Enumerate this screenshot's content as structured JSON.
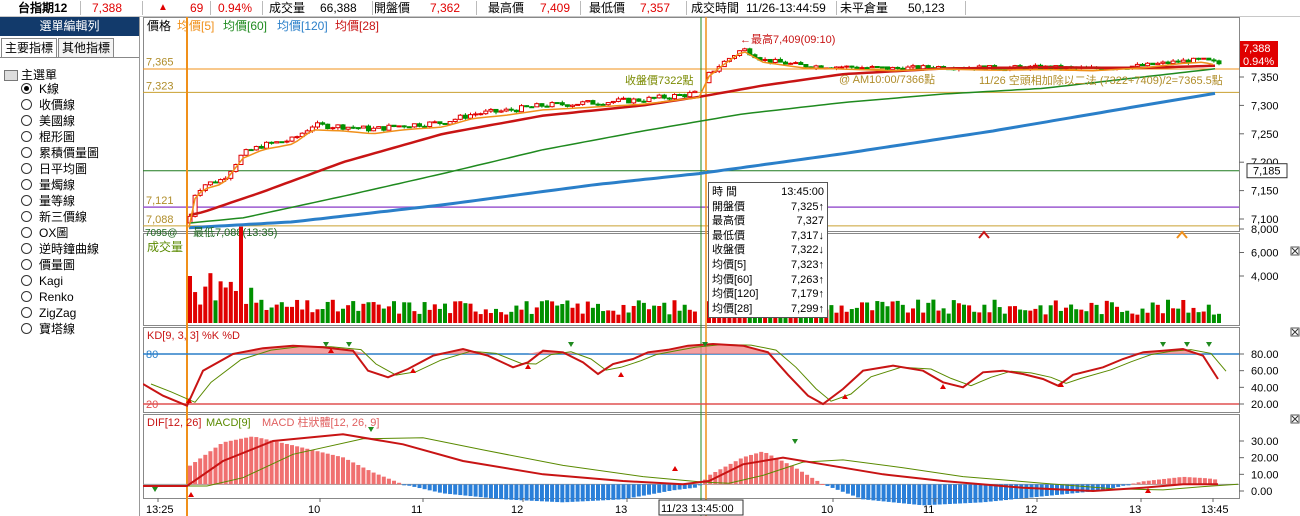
{
  "quote_bar": {
    "symbol": "台指期12",
    "last": "7,388",
    "change_arrow": "▲",
    "change": "69",
    "change_pct": "0.94%",
    "volume_label": "成交量",
    "volume": "66,388",
    "open_label": "開盤價",
    "open": "7,362",
    "high_label": "最高價",
    "high": "7,409",
    "low_label": "最低價",
    "low": "7,357",
    "time_label": "成交時間",
    "time": "11/26-13:44:59",
    "oi_label": "未平倉量",
    "oi": "50,123",
    "up_color": "#e00000"
  },
  "sidebar": {
    "title": "選單編輯列",
    "tabs": [
      "主要指標",
      "其他指標"
    ],
    "root_label": "主選單",
    "items": [
      "K線",
      "收價線",
      "美國線",
      "棍形圖",
      "累積價量圖",
      "日平均圖",
      "量燭線",
      "量等線",
      "新三價線",
      "OX圖",
      "逆時鐘曲線",
      "價量圖",
      "Kagi",
      "Renko",
      "ZigZag",
      "寶塔線"
    ],
    "selected_index": 0
  },
  "price_panel": {
    "legend": [
      {
        "text": "價格",
        "color": "#000000"
      },
      {
        "text": "均價[5]",
        "color": "#f0901a"
      },
      {
        "text": "均價[60]",
        "color": "#1f8a1f"
      },
      {
        "text": "均價[120]",
        "color": "#2a7fc9"
      },
      {
        "text": "均價[28]",
        "color": "#c81414"
      }
    ],
    "y_ticks": [
      "7,350",
      "7,300",
      "7,250",
      "7,200",
      "7,150",
      "7,100"
    ],
    "left_levels": [
      "7,365",
      "7,323",
      "7,121",
      "7,088"
    ],
    "right_last": "7,388",
    "right_pct": "0.94%",
    "right_level": "7,185",
    "high_annotation": "←最高7,409(09:10)",
    "close_annotation": "收盤價7322點",
    "am_annotation": "@ AM10:00/7366點",
    "midpoint_annotation": "11/26 空頭相加除以二法 (7322+7409)/2=7365.5點",
    "low_annotation": "最低7,088(13:35)",
    "low_prefix": "7095@",
    "colors": {
      "up": "#e00000",
      "down": "#009000",
      "ma5": "#f0901a",
      "ma28": "#c81414",
      "ma60": "#1f8a1f",
      "ma120": "#2a7fc9",
      "vline_orange": "#f0901a",
      "vline_green": "#1f8a1f"
    }
  },
  "volume_panel": {
    "title": "成交量",
    "y_ticks": [
      "8,000",
      "6,000",
      "4,000"
    ]
  },
  "kd_panel": {
    "title": "KD[9, 3, 3]  %K  %D",
    "k_color": "#c81414",
    "d_color": "#5a8a00",
    "level_80": "80",
    "level_20": "20",
    "y_ticks": [
      "80.00",
      "60.00",
      "40.00",
      "20.00"
    ]
  },
  "macd_panel": {
    "legend": [
      {
        "text": "DIF[12, 26]",
        "color": "#c81414"
      },
      {
        "text": "MACD[9]",
        "color": "#5a8a00"
      },
      {
        "text": "MACD 柱狀體[12, 26, 9]",
        "color": "#e06060"
      }
    ],
    "y_ticks": [
      "30.00",
      "20.00",
      "10.00",
      "0.00"
    ]
  },
  "x_axis": {
    "labels": [
      "13:25",
      "10",
      "11",
      "12",
      "13",
      "10",
      "11",
      "12",
      "13",
      "13:45"
    ],
    "cursor_label": "11/23  13:45:00"
  },
  "info_box": {
    "rows": [
      {
        "label": "時  間",
        "value": "13:45:00"
      },
      {
        "label": "開盤價",
        "value": "7,325↑"
      },
      {
        "label": "最高價",
        "value": "7,327"
      },
      {
        "label": "最低價",
        "value": "7,317↓"
      },
      {
        "label": "收盤價",
        "value": "7,322↓"
      },
      {
        "label": "均價[5]",
        "value": "7,323↑"
      },
      {
        "label": "均價[60]",
        "value": "7,263↑"
      },
      {
        "label": "均價[120]",
        "value": "7,179↑"
      },
      {
        "label": "均價[28]",
        "value": "7,299↑"
      }
    ]
  }
}
